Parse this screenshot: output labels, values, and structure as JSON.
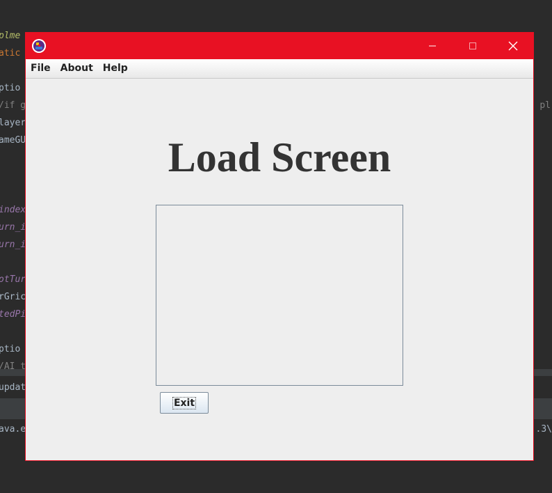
{
  "ide_background": {
    "lines": [
      {
        "text": "plme",
        "style": "c-green"
      },
      {
        "text": "atic",
        "style": "c-orange"
      },
      {
        "text": "ptio",
        "style": "c-default"
      },
      {
        "text": "/if g",
        "style": "c-gray"
      },
      {
        "text": "layer",
        "style": "c-default"
      },
      {
        "text": "ameGU",
        "style": "c-default"
      },
      {
        "text": "index",
        "style": "c-purple"
      },
      {
        "text": "urn_i",
        "style": "c-purple"
      },
      {
        "text": "urn_i",
        "style": "c-purple"
      },
      {
        "text": "otTur",
        "style": "c-purple"
      },
      {
        "text": "rGric",
        "style": "c-default"
      },
      {
        "text": "tedPi",
        "style": "c-purple"
      },
      {
        "text": "ptio",
        "style": "c-default"
      },
      {
        "text": "/AI t",
        "style": "c-gray"
      },
      {
        "text": "updat",
        "style": "c-default"
      },
      {
        "text": "ava.e",
        "style": "c-default"
      }
    ],
    "right_fragments": [
      "pl",
      ".3\\"
    ]
  },
  "window": {
    "title_bar_color": "#e81123",
    "app_icon": "java-app-icon",
    "controls": {
      "minimize_icon": "minimize-icon",
      "maximize_icon": "maximize-icon",
      "close_icon": "close-icon"
    }
  },
  "menu": {
    "items": [
      {
        "label": "File"
      },
      {
        "label": "About"
      },
      {
        "label": "Help"
      }
    ]
  },
  "main": {
    "heading": "Load Screen",
    "text_area_value": "",
    "exit_button_label": "Exit"
  }
}
